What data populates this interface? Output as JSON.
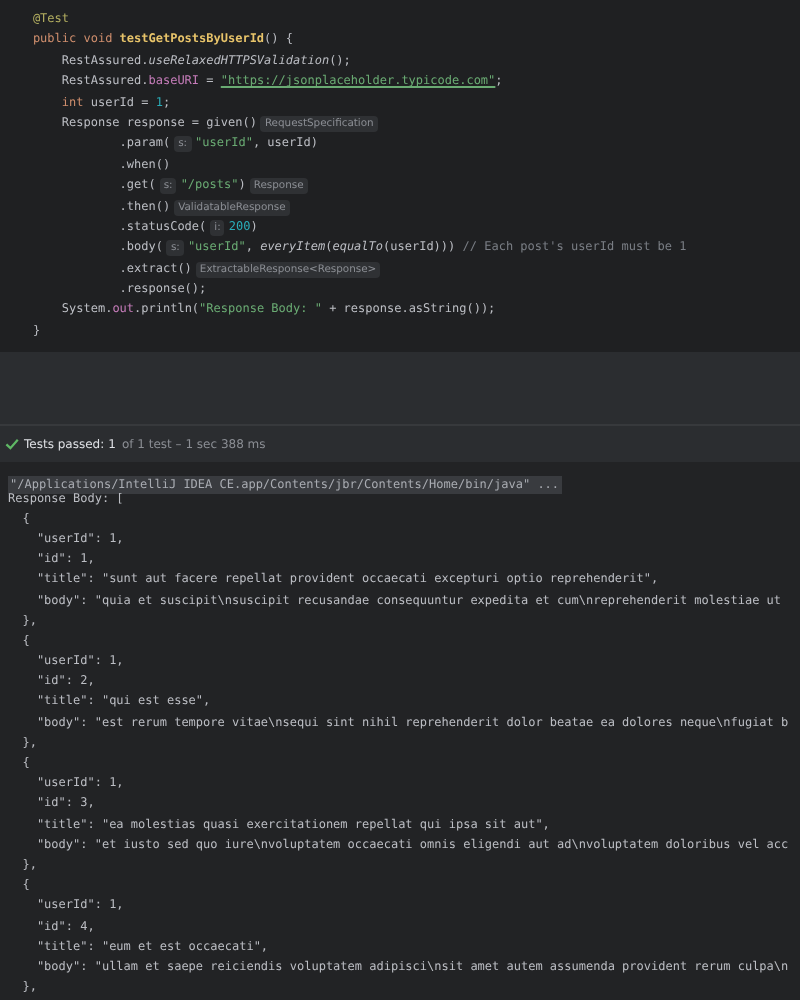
{
  "editor": {
    "lines": [
      {
        "tokens": [
          {
            "text": "    @Test",
            "kind": "annotation"
          }
        ]
      },
      {
        "tokens": [
          {
            "text": "    public void ",
            "kind": "keyword"
          },
          {
            "text": "testGetPostsByUserId",
            "kind": "method"
          },
          {
            "text": "() {",
            "kind": "plain"
          }
        ]
      },
      {
        "tokens": [
          {
            "text": "        RestAssured.",
            "kind": "plain"
          },
          {
            "text": "useRelaxedHTTPSValidation",
            "kind": "static"
          },
          {
            "text": "();",
            "kind": "plain"
          }
        ]
      },
      {
        "tokens": [
          {
            "text": "        RestAssured.",
            "kind": "plain"
          },
          {
            "text": "baseURI",
            "kind": "field"
          },
          {
            "text": " = ",
            "kind": "plain"
          },
          {
            "text": "\"https://jsonplaceholder.typicode.com\"",
            "kind": "link"
          },
          {
            "text": ";",
            "kind": "plain"
          }
        ]
      },
      {
        "tokens": [
          {
            "text": "        int ",
            "kind": "keyword"
          },
          {
            "text": "userId = ",
            "kind": "plain"
          },
          {
            "text": "1",
            "kind": "number"
          },
          {
            "text": ";",
            "kind": "plain"
          }
        ]
      },
      {
        "tokens": [
          {
            "text": "        Response response = given()",
            "kind": "plain"
          },
          {
            "text": "RequestSpecification",
            "kind": "hint"
          }
        ]
      },
      {
        "tokens": [
          {
            "text": "                .param(",
            "kind": "plain"
          },
          {
            "text": "s:",
            "kind": "hint"
          },
          {
            "text": "\"userId\"",
            "kind": "string"
          },
          {
            "text": ", userId)",
            "kind": "plain"
          }
        ]
      },
      {
        "tokens": [
          {
            "text": "                .when()",
            "kind": "plain"
          }
        ]
      },
      {
        "tokens": [
          {
            "text": "                .get(",
            "kind": "plain"
          },
          {
            "text": "s:",
            "kind": "hint"
          },
          {
            "text": "\"/posts\"",
            "kind": "string"
          },
          {
            "text": ")",
            "kind": "plain"
          },
          {
            "text": "Response",
            "kind": "hint"
          }
        ]
      },
      {
        "tokens": [
          {
            "text": "                .then()",
            "kind": "plain"
          },
          {
            "text": "ValidatableResponse",
            "kind": "hint"
          }
        ]
      },
      {
        "tokens": [
          {
            "text": "                .statusCode(",
            "kind": "plain"
          },
          {
            "text": "i:",
            "kind": "hint"
          },
          {
            "text": "200",
            "kind": "number"
          },
          {
            "text": ")",
            "kind": "plain"
          }
        ]
      },
      {
        "tokens": [
          {
            "text": "                .body(",
            "kind": "plain"
          },
          {
            "text": "s:",
            "kind": "hint"
          },
          {
            "text": "\"userId\"",
            "kind": "string"
          },
          {
            "text": ", ",
            "kind": "plain"
          },
          {
            "text": "everyItem",
            "kind": "static"
          },
          {
            "text": "(",
            "kind": "plain"
          },
          {
            "text": "equalTo",
            "kind": "static"
          },
          {
            "text": "(userId))) ",
            "kind": "plain"
          },
          {
            "text": "// Each post's userId must be 1",
            "kind": "comment"
          }
        ]
      },
      {
        "tokens": [
          {
            "text": "                .extract()",
            "kind": "plain"
          },
          {
            "text": "ExtractableResponse<Response>",
            "kind": "hint"
          }
        ]
      },
      {
        "tokens": [
          {
            "text": "                .response();",
            "kind": "plain"
          }
        ]
      },
      {
        "tokens": [
          {
            "text": "        System.",
            "kind": "plain"
          },
          {
            "text": "out",
            "kind": "field"
          },
          {
            "text": ".println(",
            "kind": "plain"
          },
          {
            "text": "\"Response Body: \"",
            "kind": "string"
          },
          {
            "text": " + response.asString());",
            "kind": "plain"
          }
        ]
      },
      {
        "tokens": [
          {
            "text": "    }",
            "kind": "plain"
          }
        ]
      }
    ]
  },
  "test_status": {
    "label": "Tests passed:",
    "count": "1",
    "detail": "of 1 test – 1 sec 388 ms"
  },
  "console": {
    "command": "\"/Applications/IntelliJ IDEA CE.app/Contents/jbr/Contents/Home/bin/java\" ...",
    "lines": [
      "Response Body: [",
      "  {",
      "    \"userId\": 1,",
      "    \"id\": 1,",
      "    \"title\": \"sunt aut facere repellat provident occaecati excepturi optio reprehenderit\",",
      "    \"body\": \"quia et suscipit\\nsuscipit recusandae consequuntur expedita et cum\\nreprehenderit molestiae ut",
      "  },",
      "  {",
      "    \"userId\": 1,",
      "    \"id\": 2,",
      "    \"title\": \"qui est esse\",",
      "    \"body\": \"est rerum tempore vitae\\nsequi sint nihil reprehenderit dolor beatae ea dolores neque\\nfugiat b",
      "  },",
      "  {",
      "    \"userId\": 1,",
      "    \"id\": 3,",
      "    \"title\": \"ea molestias quasi exercitationem repellat qui ipsa sit aut\",",
      "    \"body\": \"et iusto sed quo iure\\nvoluptatem occaecati omnis eligendi aut ad\\nvoluptatem doloribus vel acc",
      "  },",
      "  {",
      "    \"userId\": 1,",
      "    \"id\": 4,",
      "    \"title\": \"eum et est occaecati\",",
      "    \"body\": \"ullam et saepe reiciendis voluptatem adipisci\\nsit amet autem assumenda provident rerum culpa\\n",
      "  },"
    ]
  }
}
